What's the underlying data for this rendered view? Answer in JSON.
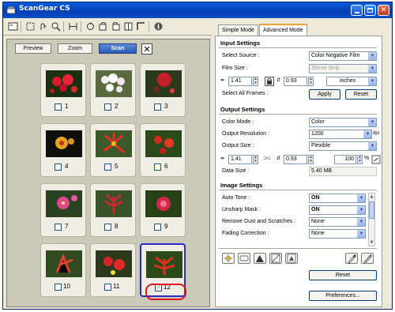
{
  "window": {
    "title": "ScanGear CS"
  },
  "left": {
    "preview_label": "Preview",
    "zoom_label": "Zoom",
    "scan_label": "Scan",
    "clear_label": "✕",
    "frames": [
      {
        "number": "1",
        "checked": false
      },
      {
        "number": "2",
        "checked": false
      },
      {
        "number": "3",
        "checked": false
      },
      {
        "number": "4",
        "checked": false
      },
      {
        "number": "5",
        "checked": false
      },
      {
        "number": "6",
        "checked": false
      },
      {
        "number": "7",
        "checked": false
      },
      {
        "number": "8",
        "checked": false
      },
      {
        "number": "9",
        "checked": false
      },
      {
        "number": "10",
        "checked": false
      },
      {
        "number": "11",
        "checked": false
      },
      {
        "number": "12",
        "checked": true
      }
    ]
  },
  "tabs": {
    "simple": "Simple Mode",
    "advanced": "Advanced Mode"
  },
  "input_settings": {
    "title": "Input Settings",
    "select_source_label": "Select Source :",
    "select_source_value": "Color Negative Film",
    "film_size_label": "Film Size :",
    "film_size_value": "35mm Strip",
    "width_value": "1.41",
    "height_value": "0.93",
    "units_value": "inches",
    "select_all_frames_label": "Select All Frames :",
    "apply_label": "Apply",
    "reset_label": "Reset"
  },
  "output_settings": {
    "title": "Output Settings",
    "color_mode_label": "Color Mode :",
    "color_mode_value": "Color",
    "resolution_label": "Output Resolution :",
    "resolution_value": "1200",
    "resolution_unit": "dpi",
    "output_size_label": "Output Size :",
    "output_size_value": "Flexible",
    "width_value": "1.41",
    "height_value": "0.93",
    "scale_value": "100",
    "scale_unit": "%",
    "data_size_label": "Data Size :",
    "data_size_value": "5.40 MB"
  },
  "image_settings": {
    "title": "Image Settings",
    "rows": [
      {
        "label": "Auto Tone :",
        "value": "ON"
      },
      {
        "label": "Unsharp Mask :",
        "value": "ON"
      },
      {
        "label": "Remove Dust and Scratches :",
        "value": "None"
      },
      {
        "label": "Fading Correction :",
        "value": "None"
      }
    ]
  },
  "bottom": {
    "reset_label": "Reset",
    "preferences_label": "Preferences..."
  },
  "colors": {
    "title_bar": "#0a4fc8",
    "scan_button": "#2a5ab4",
    "highlight": "#e0161c",
    "selected_frame": "#2a2ac8"
  }
}
